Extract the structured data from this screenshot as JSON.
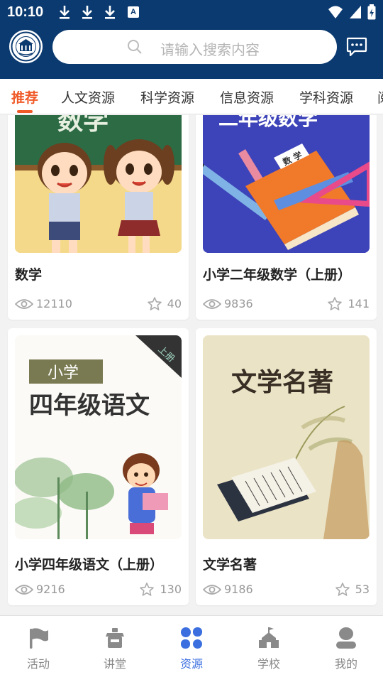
{
  "status_bar": {
    "time": "10:10",
    "badge": "A"
  },
  "header": {
    "logo_icon": "university-seal-icon",
    "search_placeholder": "请输入搜索内容",
    "message_icon": "chat-bubble-icon"
  },
  "tabs": [
    {
      "label": "推荐",
      "active": true
    },
    {
      "label": "人文资源",
      "active": false
    },
    {
      "label": "科学资源",
      "active": false
    },
    {
      "label": "信息资源",
      "active": false
    },
    {
      "label": "学科资源",
      "active": false
    },
    {
      "label": "阅",
      "active": false
    }
  ],
  "cards": [
    {
      "title": "数学",
      "views": "12110",
      "stars": "40",
      "image": "two-cartoon-kids-at-blackboard",
      "image_text": "数学"
    },
    {
      "title": "小学二年级数学（上册）",
      "views": "9836",
      "stars": "141",
      "image": "math-book-with-pencils-and-rulers",
      "image_text": "二年级数学",
      "book_label": "数 学"
    },
    {
      "title": "小学四年级语文（上册）",
      "views": "9216",
      "stars": "130",
      "image": "chinese-textbook-cover-with-girl",
      "image_text_1": "小学",
      "image_text_2": "四年级语文",
      "corner_tag": "上册"
    },
    {
      "title": "文学名著",
      "views": "9186",
      "stars": "53",
      "image": "ancient-book-and-scholar-painting",
      "image_text": "文学名著"
    }
  ],
  "bottom_nav": [
    {
      "label": "活动",
      "icon": "flag-icon",
      "active": false
    },
    {
      "label": "讲堂",
      "icon": "classroom-icon",
      "active": false
    },
    {
      "label": "资源",
      "icon": "grid-resource-icon",
      "active": true
    },
    {
      "label": "学校",
      "icon": "school-building-icon",
      "active": false
    },
    {
      "label": "我的",
      "icon": "user-profile-icon",
      "active": false
    }
  ],
  "colors": {
    "header_bg": "#0b3a70",
    "accent_orange": "#f05a28",
    "active_blue": "#3b6fe0"
  }
}
